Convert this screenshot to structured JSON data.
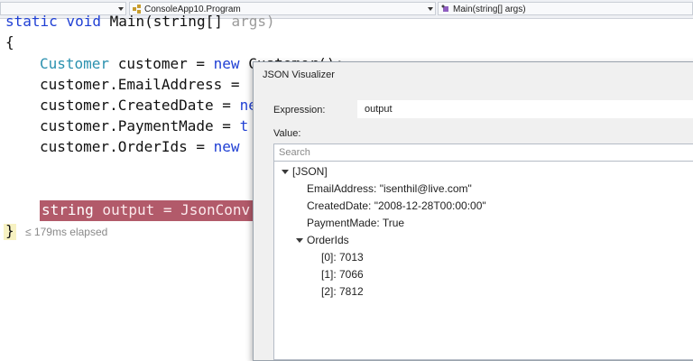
{
  "navbar": {
    "project_combo": "",
    "class_combo": "ConsoleApp10.Program",
    "member_combo": "Main(string[] args)"
  },
  "code": {
    "line0_kw": "static void",
    "line0_rest": "Main(string[] ",
    "line0_arg": "args)",
    "line1": "{",
    "line2_type": "Customer",
    "line2_rest": " customer = ",
    "line2_kw": "new",
    "line2_tail": " Customer();",
    "line3": "customer.EmailAddress =",
    "line4_a": "customer.CreatedDate = ",
    "line4_b": "ne",
    "line5_a": "customer.PaymentMade = ",
    "line5_b": "t",
    "line6_a": "customer.OrderIds = ",
    "line6_b": "new",
    "line8_kw": "string",
    "line8_rest": " output = JsonConv",
    "line9": "}",
    "elapsed": "≤ 179ms elapsed"
  },
  "visualizer": {
    "title": "JSON Visualizer",
    "expression_label": "Expression:",
    "expression_value": "output",
    "value_label": "Value:",
    "search_placeholder": "Search",
    "root": "[JSON]",
    "email": "EmailAddress: \"isenthil@live.com\"",
    "created": "CreatedDate: \"2008-12-28T00:00:00\"",
    "payment": "PaymentMade: True",
    "orderids": "OrderIds",
    "item0": "[0]: 7013",
    "item1": "[1]: 7066",
    "item2": "[2]: 7812"
  },
  "colors": {
    "keyword": "#1f3fd4",
    "type": "#2b91af",
    "highlight": "#b25a6a"
  }
}
